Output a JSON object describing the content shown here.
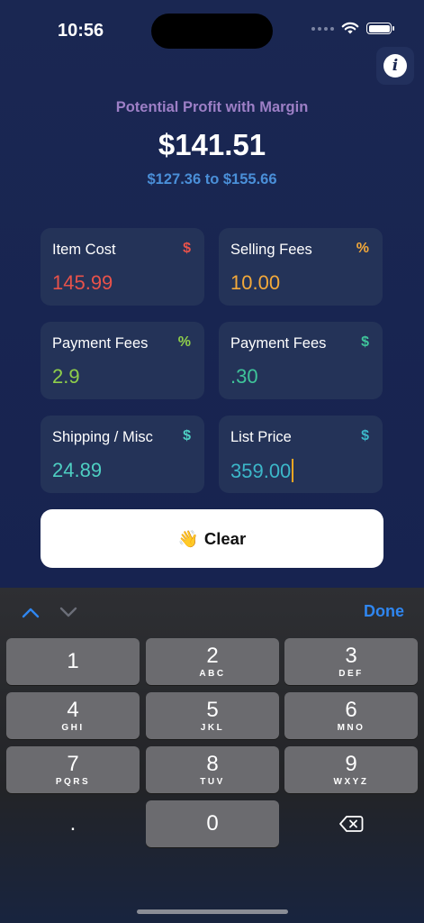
{
  "status_bar": {
    "time": "10:56"
  },
  "result": {
    "title": "Potential Profit with Margin",
    "amount": "$141.51",
    "range": "$127.36 to $155.66"
  },
  "fields": [
    {
      "label": "Item Cost",
      "symbol": "$",
      "value": "145.99",
      "label_color": "#ffffff",
      "symbol_color": "#e8524a",
      "value_color": "#e8524a"
    },
    {
      "label": "Selling Fees",
      "symbol": "%",
      "value": "10.00",
      "symbol_color": "#f3a93a",
      "value_color": "#f3a93a"
    },
    {
      "label": "Payment Fees",
      "symbol": "%",
      "value": "2.9",
      "symbol_color": "#8fcf4a",
      "value_color": "#8fcf4a"
    },
    {
      "label": "Payment Fees",
      "symbol": "$",
      "value": ".30",
      "symbol_color": "#3fc49a",
      "value_color": "#3fc49a"
    },
    {
      "label": "Shipping / Misc",
      "symbol": "$",
      "value": "24.89",
      "symbol_color": "#4ecfc2",
      "value_color": "#4ecfc2"
    },
    {
      "label": "List Price",
      "symbol": "$",
      "value": "359.00",
      "symbol_color": "#3cb7c9",
      "value_color": "#3cb7c9"
    }
  ],
  "clear_button": {
    "emoji": "👋",
    "label": "Clear"
  },
  "keyboard": {
    "done_label": "Done",
    "keys": [
      {
        "num": "1",
        "sub": ""
      },
      {
        "num": "2",
        "sub": "ABC"
      },
      {
        "num": "3",
        "sub": "DEF"
      },
      {
        "num": "4",
        "sub": "GHI"
      },
      {
        "num": "5",
        "sub": "JKL"
      },
      {
        "num": "6",
        "sub": "MNO"
      },
      {
        "num": "7",
        "sub": "PQRS"
      },
      {
        "num": "8",
        "sub": "TUV"
      },
      {
        "num": "9",
        "sub": "WXYZ"
      },
      {
        "num": ".",
        "sub": ""
      },
      {
        "num": "0",
        "sub": ""
      }
    ]
  },
  "icons": {
    "info": "info-icon",
    "wifi": "wifi-icon",
    "battery": "battery-icon",
    "backspace": "backspace-icon",
    "prev": "chevron-up-icon",
    "next": "chevron-down-icon"
  }
}
